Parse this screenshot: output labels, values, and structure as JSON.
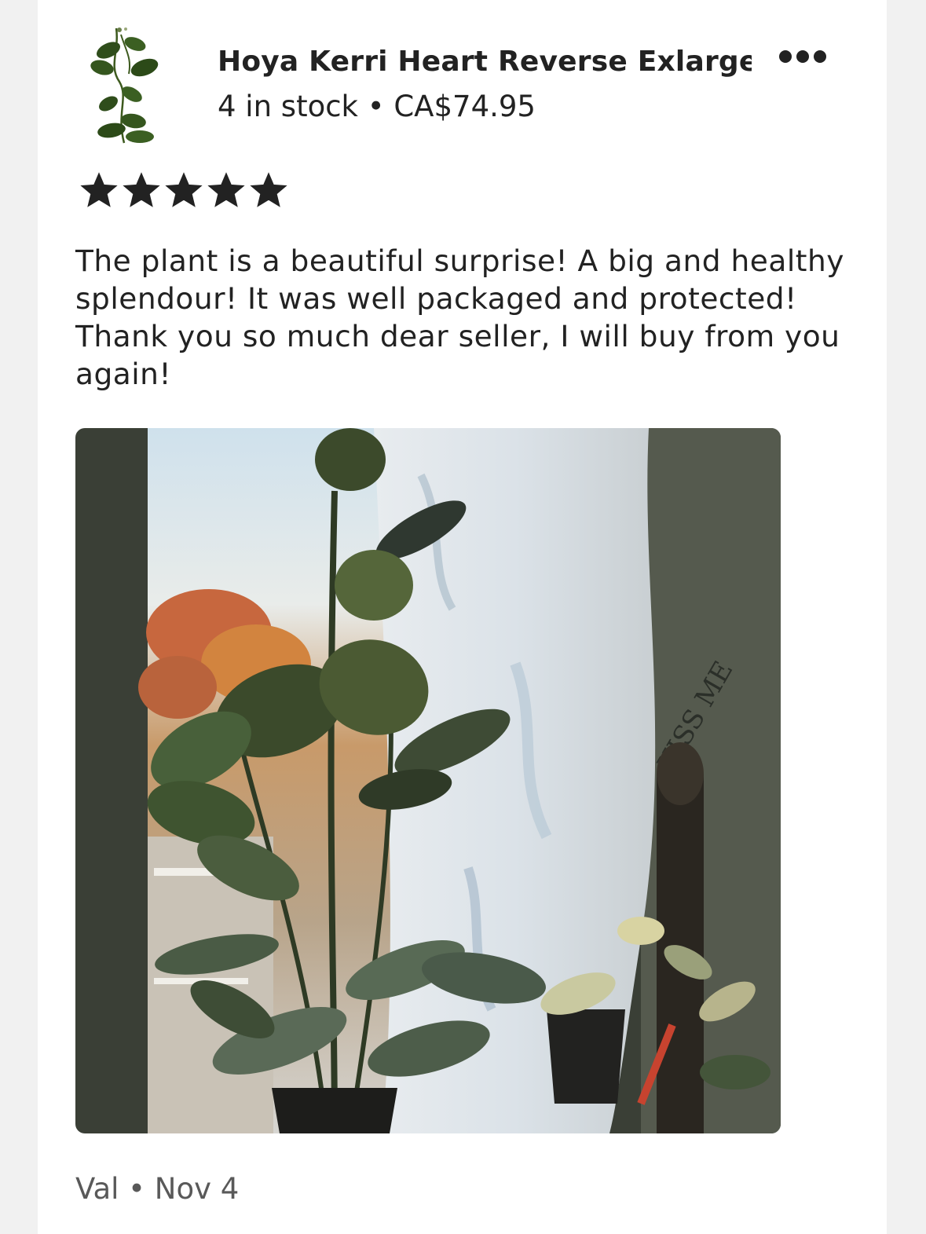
{
  "listing": {
    "thumbnail_icon": "hoya-plant-thumbnail",
    "title": "Hoya Kerri Heart Reverse Exlarge...",
    "stock": "4 in stock",
    "separator": "•",
    "price": "CA$74.95",
    "more_icon": "more-horizontal-icon"
  },
  "review": {
    "rating": 5,
    "rating_max": 5,
    "text": "The plant is a beautiful surprise! A big and healthy splendour! It was well packaged and protected! Thank you so much dear seller, I will buy from you again!",
    "photo_icon": "review-photo-hoya-plant-by-window",
    "reviewer": "Val",
    "separator": "•",
    "date": "Nov 4"
  },
  "colors": {
    "text": "#222222",
    "muted": "#595959",
    "star": "#222222",
    "background": "#f1f1f1",
    "card": "#ffffff"
  }
}
